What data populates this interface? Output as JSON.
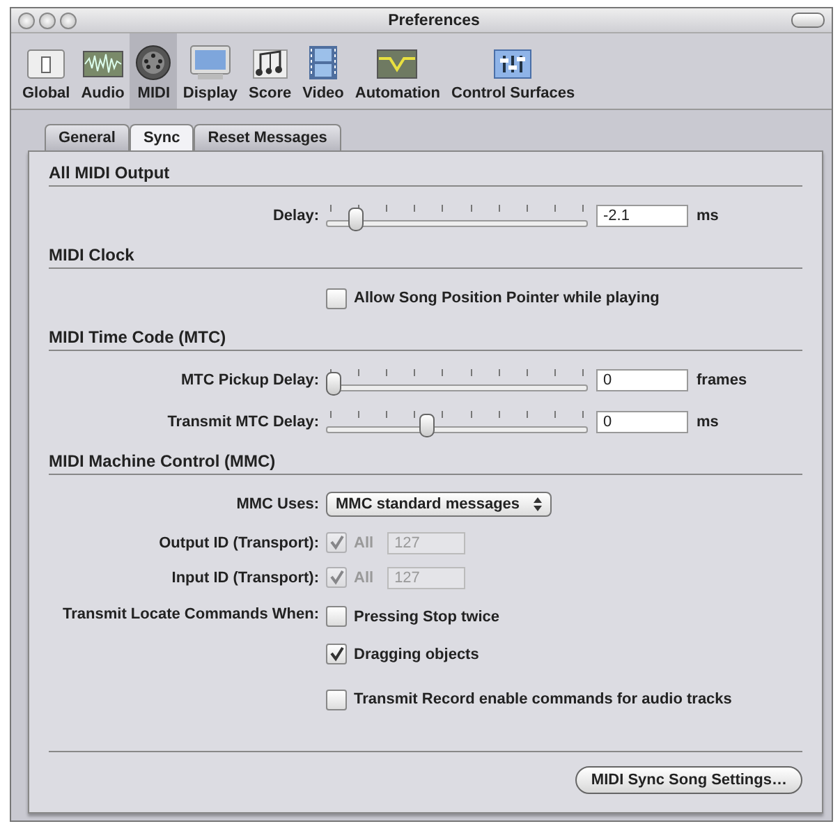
{
  "window": {
    "title": "Preferences"
  },
  "toolbar": [
    {
      "label": "Global",
      "selected": false
    },
    {
      "label": "Audio",
      "selected": false
    },
    {
      "label": "MIDI",
      "selected": true
    },
    {
      "label": "Display",
      "selected": false
    },
    {
      "label": "Score",
      "selected": false
    },
    {
      "label": "Video",
      "selected": false
    },
    {
      "label": "Automation",
      "selected": false
    },
    {
      "label": "Control Surfaces",
      "selected": false
    }
  ],
  "tabs": [
    {
      "label": "General",
      "selected": false
    },
    {
      "label": "Sync",
      "selected": true
    },
    {
      "label": "Reset Messages",
      "selected": false
    }
  ],
  "sections": [
    {
      "title": "All MIDI Output",
      "rows": [
        {
          "kind": "slider",
          "label": "Delay:",
          "level": 0.09,
          "value": "-2.1",
          "unit": "ms"
        }
      ]
    },
    {
      "title": "MIDI Clock",
      "rows": [
        {
          "kind": "checkbox",
          "label": "Allow Song Position Pointer while playing",
          "checked": false
        }
      ]
    },
    {
      "title": "MIDI Time Code (MTC)",
      "rows": [
        {
          "kind": "slider",
          "label": "MTC Pickup Delay:",
          "level": 0,
          "value": "0",
          "unit": "frames"
        },
        {
          "kind": "slider",
          "label": "Transmit MTC Delay:",
          "level": 0.37,
          "value": "0",
          "unit": "ms"
        }
      ]
    },
    {
      "title": "MIDI Machine Control (MMC)",
      "rows": [
        {
          "kind": "popup",
          "label": "MMC Uses:",
          "value": "MMC standard messages"
        },
        {
          "kind": "id",
          "label": "Output ID (Transport):",
          "option": "All",
          "checked": true,
          "disabled": true,
          "value": "127"
        },
        {
          "kind": "id",
          "label": "Input ID (Transport):",
          "option": "All",
          "checked": true,
          "disabled": true,
          "value": "127"
        },
        {
          "kind": "checkgroup",
          "label": "Transmit Locate Commands When:",
          "options": [
            {
              "label": "Pressing Stop twice",
              "checked": false
            },
            {
              "label": "Dragging objects",
              "checked": true
            }
          ]
        },
        {
          "kind": "checkbox",
          "label": "Transmit Record enable commands for audio tracks",
          "checked": false
        }
      ]
    }
  ],
  "footer_button": "MIDI Sync Song Settings…"
}
